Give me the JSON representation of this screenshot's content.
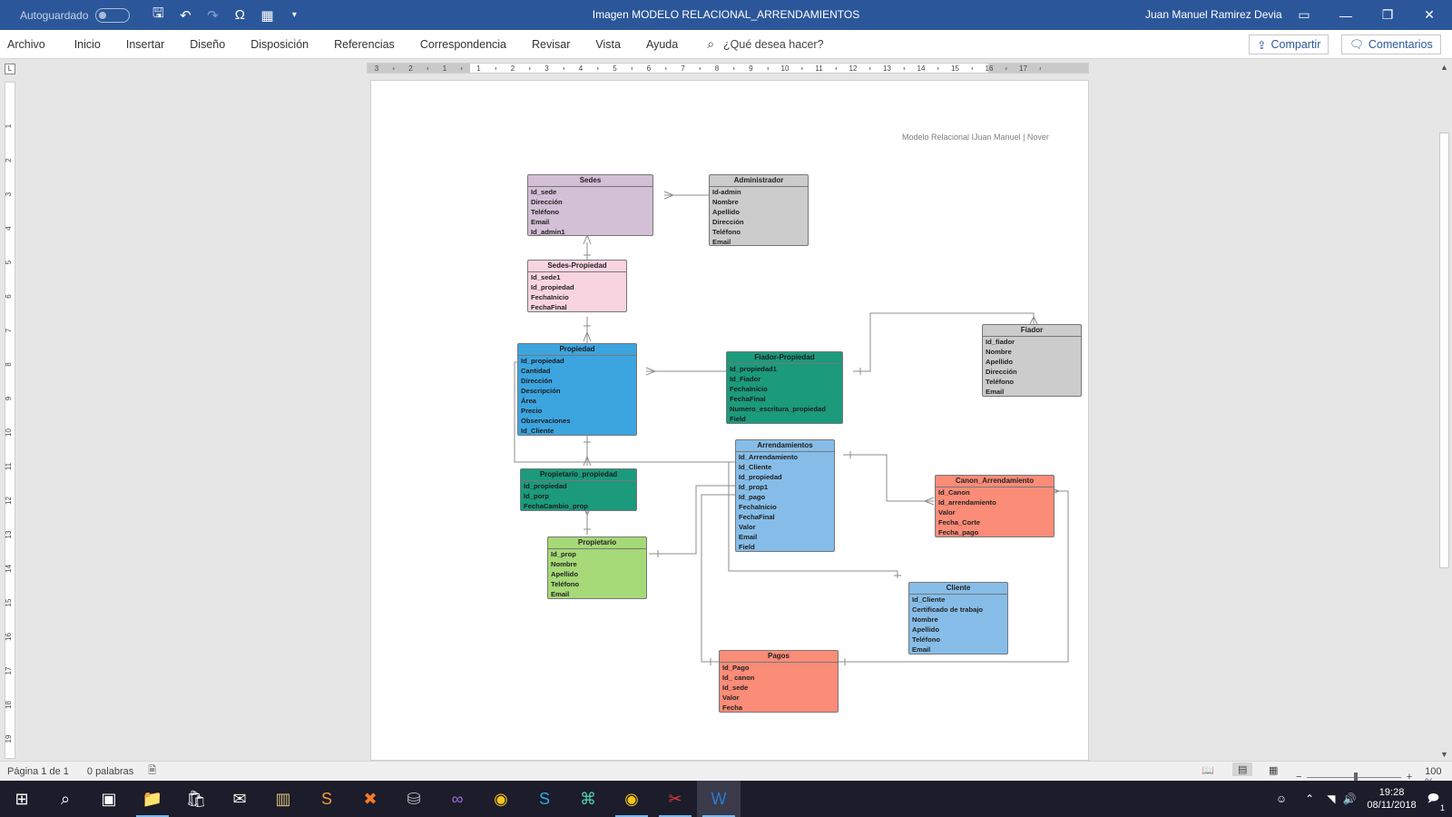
{
  "titlebar": {
    "autosave_label": "Autoguardado",
    "doc_title": "Imagen MODELO RELACIONAL_ARRENDAMIENTOS",
    "user_name": "Juan Manuel Ramirez Devia"
  },
  "menu": {
    "items": [
      "Archivo",
      "Inicio",
      "Insertar",
      "Diseño",
      "Disposición",
      "Referencias",
      "Correspondencia",
      "Revisar",
      "Vista",
      "Ayuda"
    ],
    "search_placeholder": "¿Qué desea hacer?",
    "share_label": "Compartir",
    "comments_label": "Comentarios"
  },
  "ruler": {
    "labels": [
      "3",
      "2",
      "1",
      "1",
      "2",
      "3",
      "4",
      "5",
      "6",
      "7",
      "8",
      "9",
      "10",
      "11",
      "12",
      "13",
      "14",
      "15",
      "16",
      "17"
    ],
    "vlabels": [
      "1",
      "2",
      "3",
      "4",
      "5",
      "6",
      "7",
      "8",
      "9",
      "10",
      "11",
      "12",
      "13",
      "14",
      "15",
      "16",
      "17",
      "18",
      "19"
    ]
  },
  "page": {
    "header_text": "Modelo Relacional   IJuan Manuel   |   Nover"
  },
  "er": {
    "sedes": {
      "title": "Sedes",
      "fields": [
        "Id_sede",
        "Dirección",
        "Teléfono",
        "Email",
        "Id_admin1"
      ],
      "color": "#d3bfd6"
    },
    "administrador": {
      "title": "Administrador",
      "fields": [
        "Id-admin",
        "Nombre",
        "Apellido",
        "Dirección",
        "Teléfono",
        "Email"
      ],
      "color": "#cccccc"
    },
    "sedes_propiedad": {
      "title": "Sedes-Propiedad",
      "fields": [
        "Id_sede1",
        "Id_propiedad",
        "FechaInicio",
        "FechaFinal"
      ],
      "color": "#f8d4e1"
    },
    "fiador": {
      "title": "Fiador",
      "fields": [
        "Id_fiador",
        "Nombre",
        "Apellido",
        "Dirección",
        "Teléfono",
        "Email"
      ],
      "color": "#cccccc"
    },
    "propiedad": {
      "title": "Propiedad",
      "fields": [
        "Id_propiedad",
        "Cantidad",
        "Dirección",
        "Descripción",
        "Área",
        "Precio",
        "Observaciones",
        "Id_Cliente"
      ],
      "color": "#3ca5e0"
    },
    "fiador_propiedad": {
      "title": "Fiador-Propiedad",
      "fields": [
        "Id_propiedad1",
        "Id_Fiador",
        "FechaInicio",
        "FechaFinal",
        "Numero_escritura_propiedad",
        "Field"
      ],
      "color": "#1b9a7c"
    },
    "arrendamientos": {
      "title": "Arrendamientos",
      "fields": [
        "Id_Arrendamiento",
        "Id_Cliente",
        "Id_propiedad",
        "Id_prop1",
        "Id_pago",
        "FechaInicio",
        "FechaFinal",
        "Valor",
        "Email",
        "Field"
      ],
      "color": "#86bde8"
    },
    "propietario_propiedad": {
      "title": "Propietario_propiedad",
      "fields": [
        "Id_propiedad",
        "Id_porp",
        "FechaCambio_prop"
      ],
      "color": "#1b9a7c"
    },
    "canon": {
      "title": "Canon_Arrendamiento",
      "fields": [
        "Id_Canon",
        "Id_arrendamiento",
        "Valor",
        "Fecha_Corte",
        "Fecha_pago"
      ],
      "color": "#fa8c78"
    },
    "propietario": {
      "title": "Propietario",
      "fields": [
        "Id_prop",
        "Nombre",
        "Apellido",
        "Teléfono",
        "Email"
      ],
      "color": "#a6d977"
    },
    "cliente": {
      "title": "Cliente",
      "fields": [
        "Id_Cliente",
        "Certificado de trabajo",
        "Nombre",
        "Apellido",
        "Teléfono",
        "Email"
      ],
      "color": "#86bde8"
    },
    "pagos": {
      "title": "Pagos",
      "fields": [
        "Id_Pago",
        "Id_ canon",
        "Id_sede",
        "Valor",
        "Fecha"
      ],
      "color": "#fa8c78"
    }
  },
  "status": {
    "page_info": "Página 1 de 1",
    "words": "0 palabras",
    "zoom": "100 %"
  },
  "taskbar": {
    "time": "19:28",
    "date": "08/11/2018",
    "notification_count": "1"
  }
}
